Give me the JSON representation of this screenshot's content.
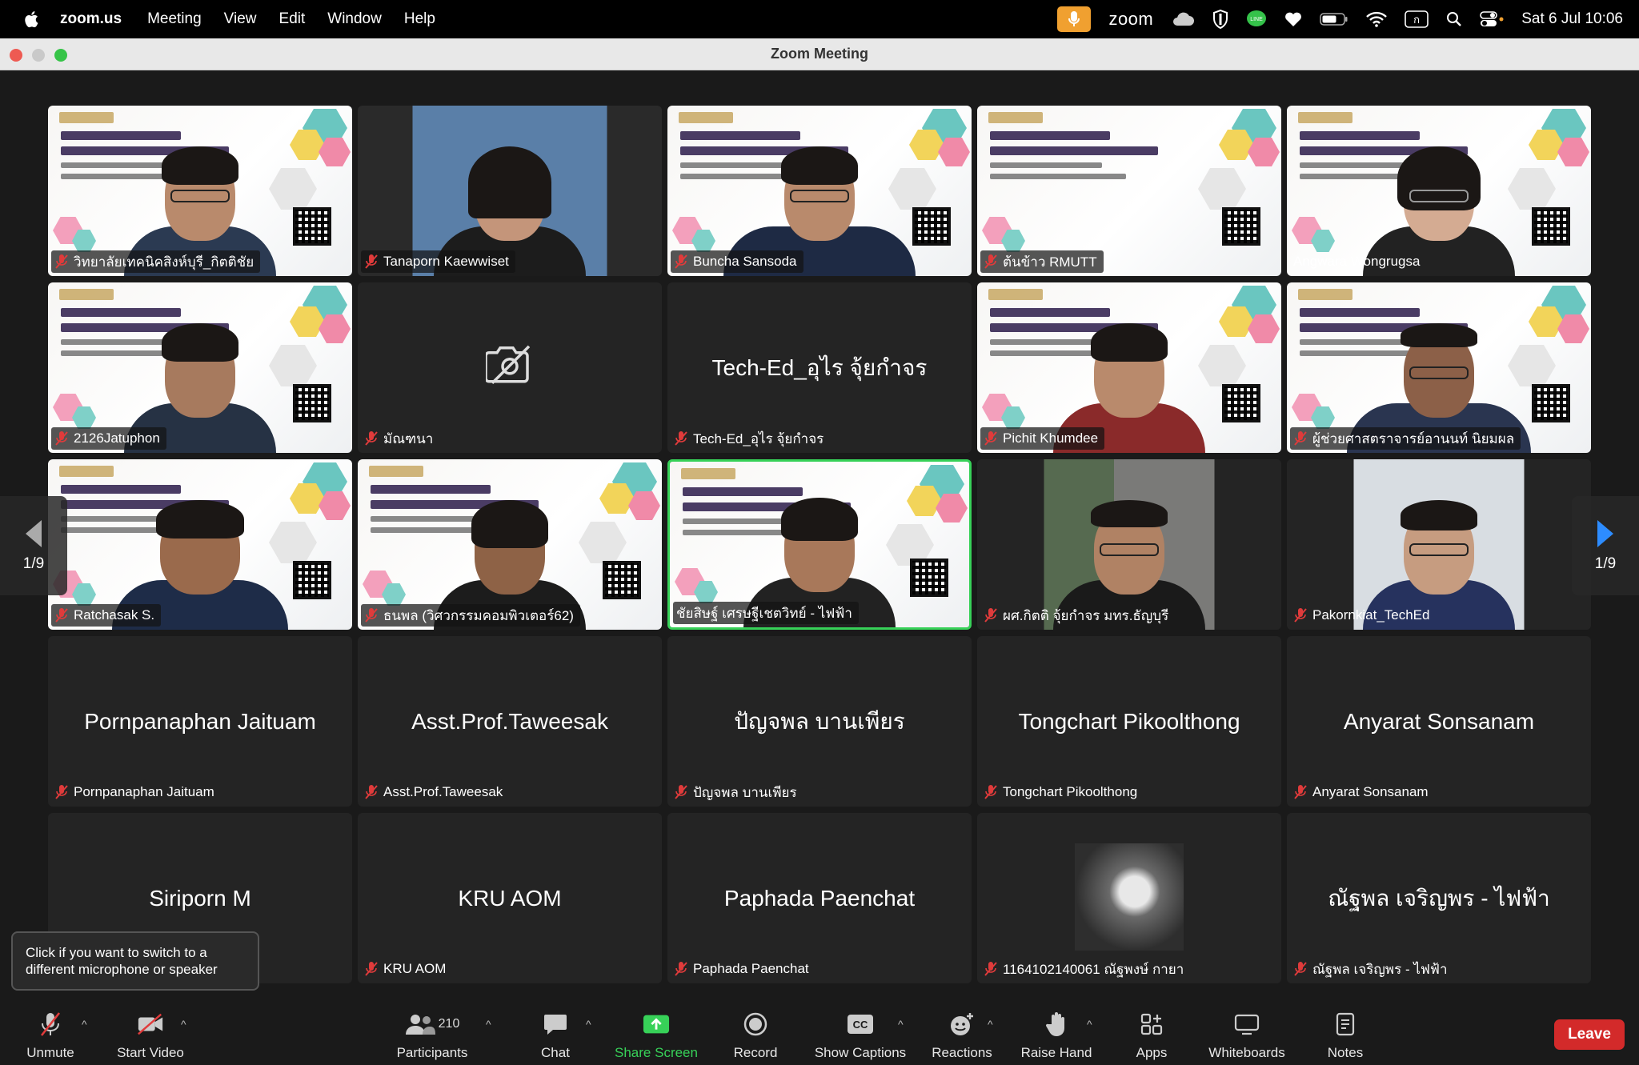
{
  "menubar": {
    "app": "zoom.us",
    "items": [
      "Meeting",
      "View",
      "Edit",
      "Window",
      "Help"
    ],
    "zoom_label": "zoom",
    "clock": "Sat 6 Jul  10:06"
  },
  "window": {
    "title": "Zoom Meeting"
  },
  "gallery": {
    "page_left": "1/9",
    "page_right": "1/9",
    "tiles": [
      {
        "label": "วิทยาลัยเทคนิคสิงห์บุรี_กิตติชัย",
        "big": ""
      },
      {
        "label": "Tanaporn Kaewwiset",
        "big": ""
      },
      {
        "label": "Buncha Sansoda",
        "big": ""
      },
      {
        "label": "ต้นข้าว RMUTT",
        "big": ""
      },
      {
        "label": "Angwara Wongrugsa",
        "big": ""
      },
      {
        "label": "2126Jatuphon",
        "big": ""
      },
      {
        "label": "มัณฑนา",
        "big": ""
      },
      {
        "label": "Tech-Ed_อุไร จุ้ยกำจร",
        "big": "Tech-Ed_อุไร จุ้ยกำจร"
      },
      {
        "label": "Pichit Khumdee",
        "big": ""
      },
      {
        "label": "ผู้ช่วยศาสตราจารย์อานนท์ นิยมผล",
        "big": ""
      },
      {
        "label": "Ratchasak S.",
        "big": ""
      },
      {
        "label": "ธนพล (วิศวกรรมคอมพิวเตอร์62)",
        "big": ""
      },
      {
        "label": "ชัยสิษฐ์ เศรษฐีเชตวิทย์ - ไฟฟ้า",
        "big": ""
      },
      {
        "label": "ผศ.กิตติ จุ้ยกำจร มทร.ธัญบุรี",
        "big": ""
      },
      {
        "label": "Pakornkiat_TechEd",
        "big": ""
      },
      {
        "label": "Pornpanaphan Jaituam",
        "big": "Pornpanaphan Jaituam"
      },
      {
        "label": "Asst.Prof.Taweesak",
        "big": "Asst.Prof.Taweesak"
      },
      {
        "label": "ปัญจพล บานเพียร",
        "big": "ปัญจพล บานเพียร"
      },
      {
        "label": "Tongchart Pikoolthong",
        "big": "Tongchart Pikoolthong"
      },
      {
        "label": "Anyarat Sonsanam",
        "big": "Anyarat Sonsanam"
      },
      {
        "label": "",
        "big": "Siriporn M"
      },
      {
        "label": "KRU AOM",
        "big": "KRU AOM"
      },
      {
        "label": "Paphada Paenchat",
        "big": "Paphada Paenchat"
      },
      {
        "label": "1164102140061 ณัฐพงษ์ กายา",
        "big": ""
      },
      {
        "label": "ณัฐพล เจริญพร - ไฟฟ้า",
        "big": "ณัฐพล เจริญพร - ไฟฟ้า"
      }
    ]
  },
  "tooltip": {
    "text": "Click if you want to switch to a different microphone or speaker"
  },
  "toolbar": {
    "unmute": "Unmute",
    "start_video": "Start Video",
    "participants": "Participants",
    "participants_count": "210",
    "chat": "Chat",
    "share_screen": "Share Screen",
    "record": "Record",
    "show_captions": "Show Captions",
    "reactions": "Reactions",
    "raise_hand": "Raise Hand",
    "apps": "Apps",
    "whiteboards": "Whiteboards",
    "notes": "Notes",
    "leave": "Leave"
  },
  "colors": {
    "active_speaker": "#37d158",
    "leave": "#d32a2a",
    "mute": "#e03b3b"
  }
}
